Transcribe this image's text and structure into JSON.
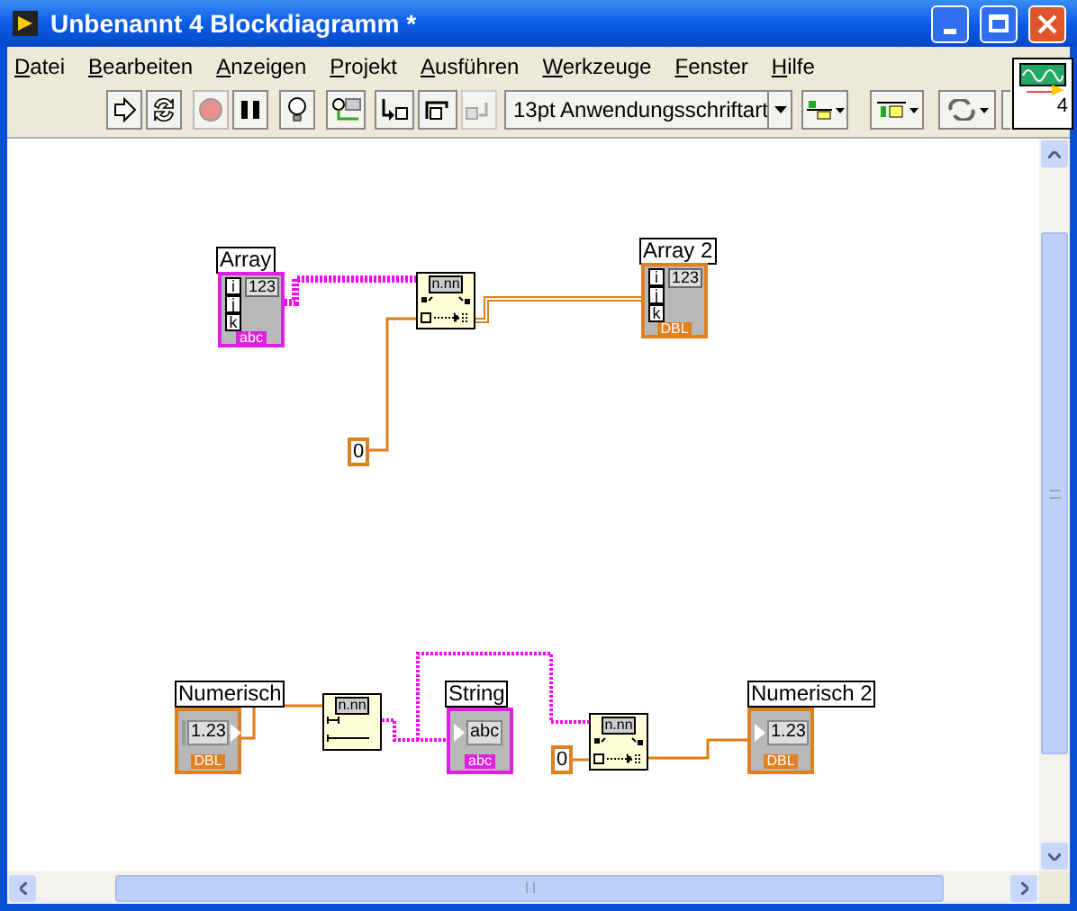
{
  "window": {
    "title": "Unbenannt 4 Blockdiagramm *"
  },
  "menu": [
    "Datei",
    "Bearbeiten",
    "Anzeigen",
    "Projekt",
    "Ausführen",
    "Werkzeuge",
    "Fenster",
    "Hilfe"
  ],
  "toolbar": {
    "font": "13pt Anwendungsschriftart",
    "vi_number": "4"
  },
  "terminals": [
    {
      "label": "Array",
      "kind": "array",
      "type": "abc",
      "display": "123",
      "indices": [
        "i",
        "j",
        "k"
      ],
      "color": "#e020e0"
    },
    {
      "label": "Array 2",
      "kind": "array",
      "type": "DBL",
      "display": "123",
      "indices": [
        "i",
        "j",
        "k"
      ],
      "color": "#e08020"
    },
    {
      "label": "Numerisch",
      "kind": "control",
      "type": "DBL",
      "display": "1.23",
      "color": "#e08020"
    },
    {
      "label": "String",
      "kind": "indicator",
      "type": "abc",
      "display": "abc",
      "color": "#e020e0"
    },
    {
      "label": "Numerisch 2",
      "kind": "indicator",
      "type": "DBL",
      "display": "1.23",
      "color": "#e08020"
    }
  ],
  "constants": [
    {
      "value": "0"
    },
    {
      "value": "0"
    }
  ],
  "functions": [
    {
      "glyph": "n.nn"
    },
    {
      "glyph": "n.nn"
    },
    {
      "glyph": "n.nn"
    }
  ],
  "wires": [
    {
      "kind": "string_array"
    },
    {
      "kind": "numeric"
    },
    {
      "kind": "numeric_array"
    },
    {
      "kind": "numeric"
    },
    {
      "kind": "string"
    },
    {
      "kind": "string"
    },
    {
      "kind": "numeric"
    },
    {
      "kind": "numeric"
    }
  ]
}
